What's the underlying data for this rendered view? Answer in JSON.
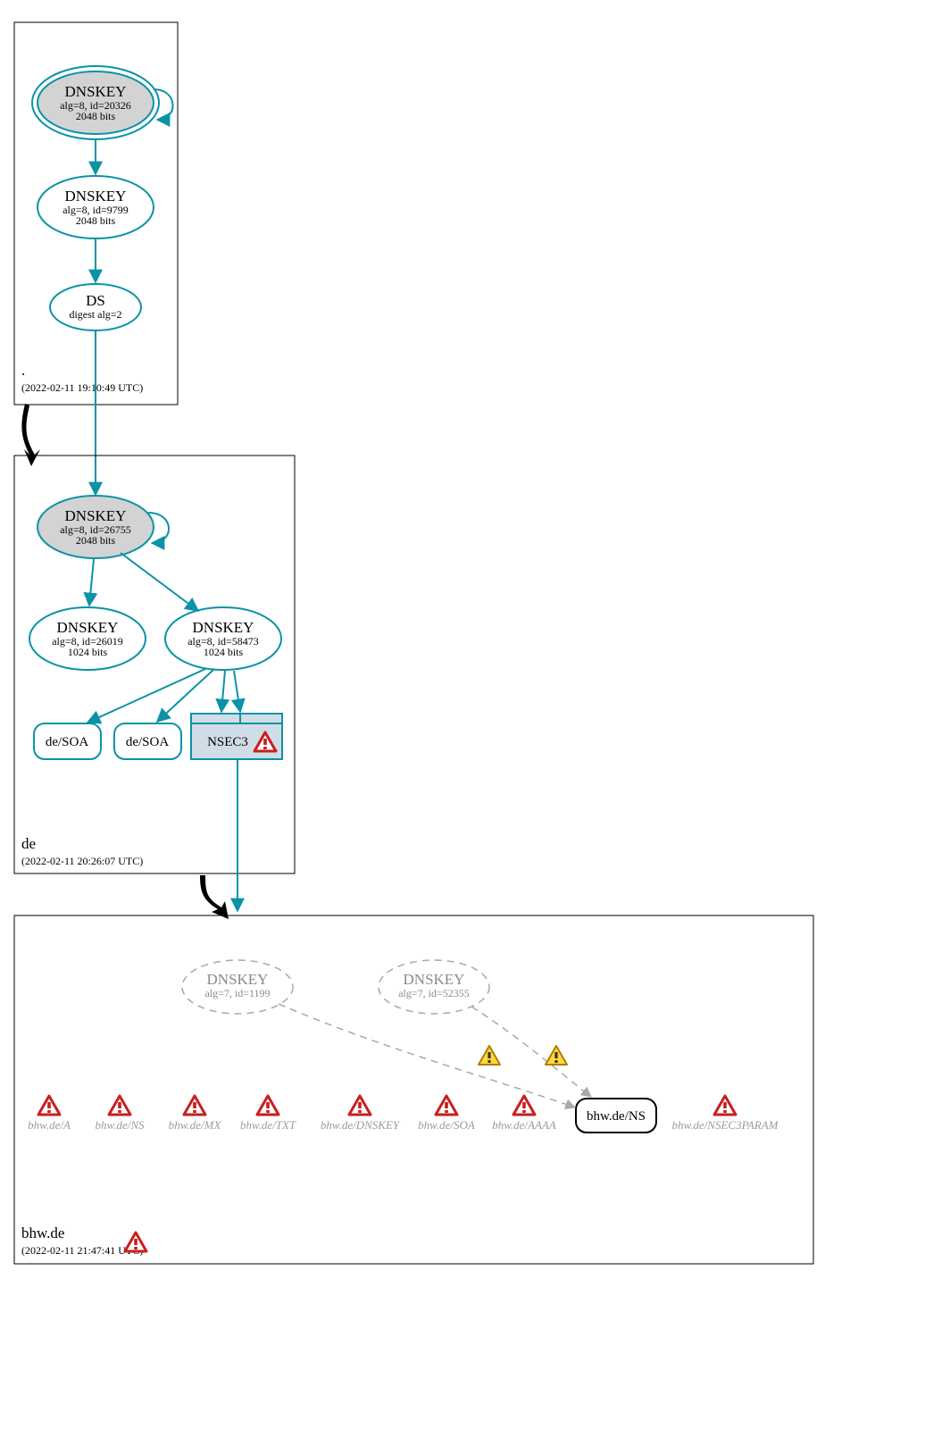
{
  "zones": {
    "root": {
      "label": ".",
      "timestamp": "(2022-02-11 19:10:49 UTC)"
    },
    "de": {
      "label": "de",
      "timestamp": "(2022-02-11 20:26:07 UTC)"
    },
    "bhw": {
      "label": "bhw.de",
      "timestamp": "(2022-02-11 21:47:41 UTC)"
    }
  },
  "nodes": {
    "root_ksk": {
      "title": "DNSKEY",
      "sub1": "alg=8, id=20326",
      "sub2": "2048 bits"
    },
    "root_zsk": {
      "title": "DNSKEY",
      "sub1": "alg=8, id=9799",
      "sub2": "2048 bits"
    },
    "root_ds": {
      "title": "DS",
      "sub1": "digest alg=2",
      "sub2": ""
    },
    "de_ksk": {
      "title": "DNSKEY",
      "sub1": "alg=8, id=26755",
      "sub2": "2048 bits"
    },
    "de_zsk_a": {
      "title": "DNSKEY",
      "sub1": "alg=8, id=26019",
      "sub2": "1024 bits"
    },
    "de_zsk_b": {
      "title": "DNSKEY",
      "sub1": "alg=8, id=58473",
      "sub2": "1024 bits"
    },
    "de_soa_a": {
      "title": "de/SOA"
    },
    "de_soa_b": {
      "title": "de/SOA"
    },
    "de_nsec3": {
      "title": "NSEC3"
    },
    "bhw_key_a": {
      "title": "DNSKEY",
      "sub1": "alg=7, id=1199"
    },
    "bhw_key_b": {
      "title": "DNSKEY",
      "sub1": "alg=7, id=52355"
    },
    "bhw_ns": {
      "title": "bhw.de/NS"
    },
    "rr_a": "bhw.de/A",
    "rr_ns": "bhw.de/NS",
    "rr_mx": "bhw.de/MX",
    "rr_txt": "bhw.de/TXT",
    "rr_dnskey": "bhw.de/DNSKEY",
    "rr_soa": "bhw.de/SOA",
    "rr_aaaa": "bhw.de/AAAA",
    "rr_nsec3p": "bhw.de/NSEC3PARAM"
  },
  "icons": {
    "warn_err": "error-triangle-icon",
    "warn_yel": "warning-triangle-icon"
  }
}
